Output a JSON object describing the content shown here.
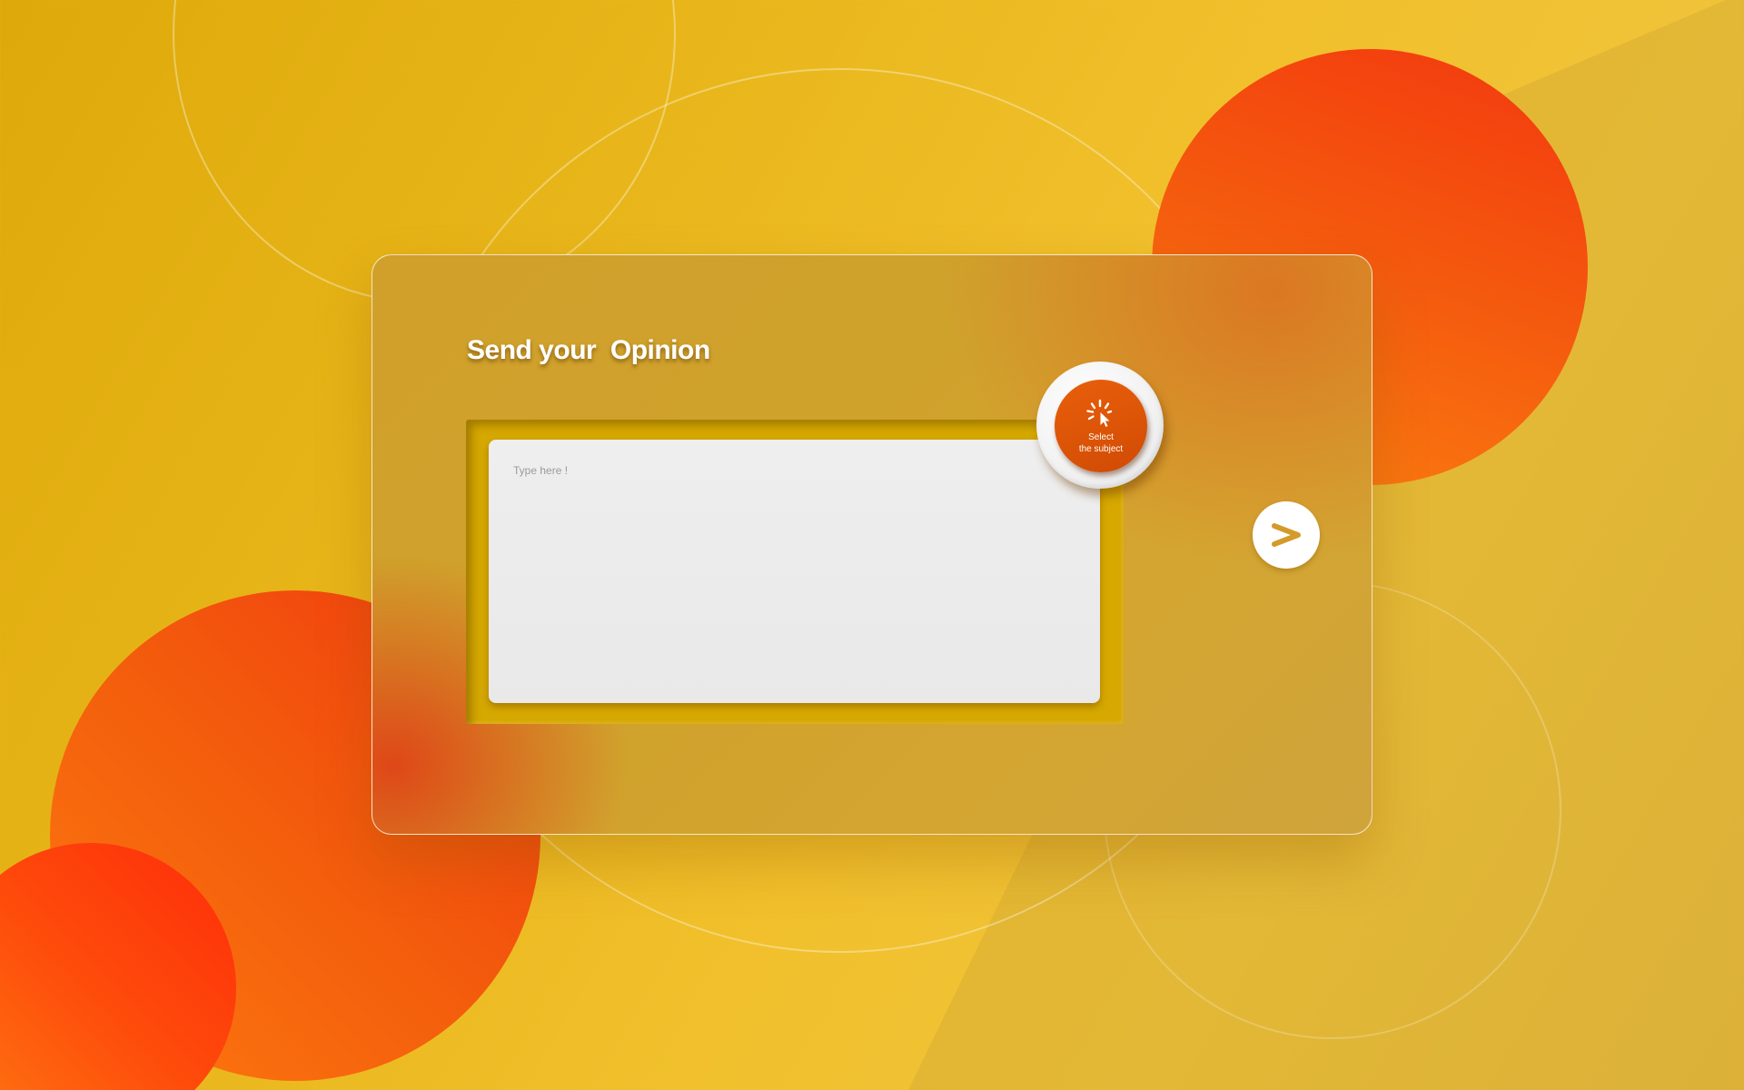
{
  "form": {
    "title": "Send your  Opinion",
    "textarea_placeholder": "Type here !",
    "subject_button": {
      "line1": "Select",
      "line2": "the subject",
      "icon": "loading-cursor-icon"
    },
    "send_button": {
      "icon": "chevron-right-icon"
    }
  },
  "colors": {
    "accent": "#dc5406",
    "card": "#cfa22c",
    "inset": "#d6a800",
    "send_icon": "#d49a2a"
  }
}
